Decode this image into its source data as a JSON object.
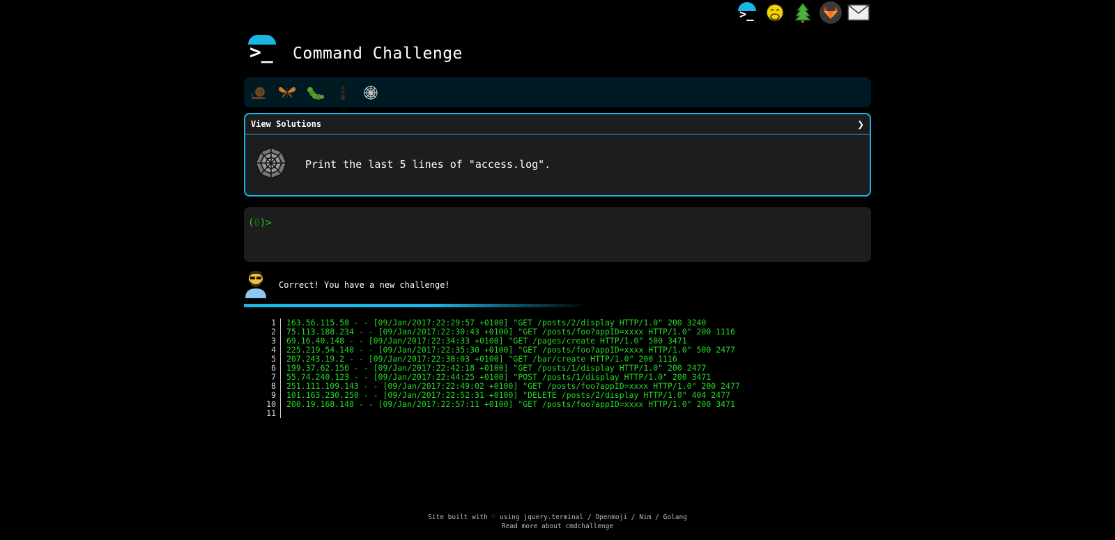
{
  "header": {
    "title": "Command Challenge"
  },
  "top_icons": [
    "terminal-icon",
    "face-with-hand-over-mouth-icon",
    "evergreen-tree-icon",
    "gitlab-icon",
    "envelope-icon"
  ],
  "bug_bar": [
    "snail-icon",
    "butterfly-icon",
    "caterpillar-icon",
    "ant-icon",
    "spider-web-icon"
  ],
  "challenge": {
    "toggle_label": "View Solutions",
    "chevron": "❯",
    "description": "Print the last 5 lines of \"access.log\"."
  },
  "terminal": {
    "prompt_open": "(",
    "count": "0",
    "prompt_close": ")>"
  },
  "feedback": {
    "message": "Correct! You have a new challenge!"
  },
  "progress": {
    "fraction": 0.55
  },
  "output": {
    "lines": [
      {
        "n": "1",
        "text": "163.56.115.58 - - [09/Jan/2017:22:29:57 +0100] \"GET /posts/2/display HTTP/1.0\" 200 3240"
      },
      {
        "n": "2",
        "text": "75.113.188.234 - - [09/Jan/2017:22:30:43 +0100] \"GET /posts/foo?appID=xxxx HTTP/1.0\" 200 1116"
      },
      {
        "n": "3",
        "text": "69.16.40.148 - - [09/Jan/2017:22:34:33 +0100] \"GET /pages/create HTTP/1.0\" 500 3471"
      },
      {
        "n": "4",
        "text": "225.219.54.140 - - [09/Jan/2017:22:35:30 +0100] \"GET /posts/foo?appID=xxxx HTTP/1.0\" 500 2477"
      },
      {
        "n": "5",
        "text": "207.243.19.2 - - [09/Jan/2017:22:38:03 +0100] \"GET /bar/create HTTP/1.0\" 200 1116"
      },
      {
        "n": "6",
        "text": "199.37.62.156 - - [09/Jan/2017:22:42:18 +0100] \"GET /posts/1/display HTTP/1.0\" 200 2477"
      },
      {
        "n": "7",
        "text": "55.74.240.123 - - [09/Jan/2017:22:44:25 +0100] \"POST /posts/1/display HTTP/1.0\" 200 3471"
      },
      {
        "n": "8",
        "text": "251.111.109.143 - - [09/Jan/2017:22:49:02 +0100] \"GET /posts/foo?appID=xxxx HTTP/1.0\" 200 2477"
      },
      {
        "n": "9",
        "text": "101.163.230.250 - - [09/Jan/2017:22:52:31 +0100] \"DELETE /posts/2/display HTTP/1.0\" 404 2477"
      },
      {
        "n": "10",
        "text": "200.19.168.148 - - [09/Jan/2017:22:57:11 +0100] \"GET /posts/foo?appID=xxxx HTTP/1.0\" 200 3471"
      },
      {
        "n": "11",
        "text": ""
      }
    ]
  },
  "footer": {
    "built_prefix": "Site built with ♡ using ",
    "link_jquery": "jquery.terminal",
    "sep1": " / ",
    "link_openmoji": "Openmoji",
    "sep2": " / ",
    "link_nim": "Nim",
    "sep3": " / ",
    "link_golang": "Golang",
    "read_more": "Read more about cmdchallenge"
  },
  "colors": {
    "accent": "#1ab7e6",
    "output_green": "#22dd22",
    "panel": "#1d1d1d",
    "bug_bar": "#001a24"
  }
}
